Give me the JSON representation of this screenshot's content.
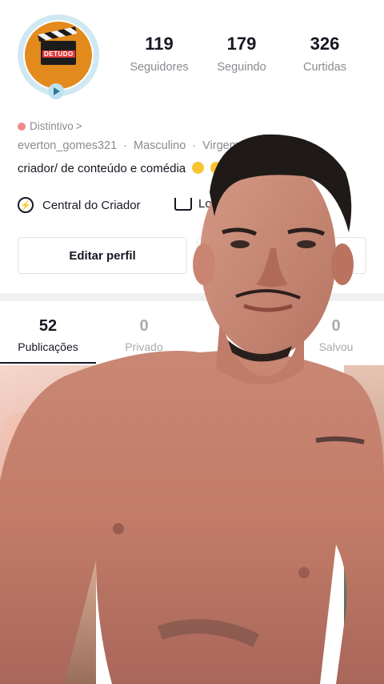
{
  "profile": {
    "username": "everton_gomes321",
    "gender": "Masculino",
    "sign": "Virgem",
    "badge_label": "Distintivo",
    "badge_chevron": ">",
    "bio": "criador/ de conteúdo e comédia",
    "avatar_text": "DETUDO"
  },
  "stats": [
    {
      "value": "119",
      "label": "Seguidores"
    },
    {
      "value": "179",
      "label": "Seguindo"
    },
    {
      "value": "326",
      "label": "Curtidas"
    }
  ],
  "actions": {
    "creator_center": "Central do Criador",
    "shop": "Loj",
    "edit_profile": "Editar perfil"
  },
  "tabs": [
    {
      "value": "52",
      "label": "Publicações",
      "active": true
    },
    {
      "value": "0",
      "label": "Privado",
      "active": false
    },
    {
      "value": "0",
      "label": "Salvou",
      "active": false
    }
  ],
  "icons": [
    "play-icon",
    "shield-icon",
    "lightning-icon",
    "cart-icon"
  ],
  "colors": {
    "text": "#161823",
    "muted": "#8a8b91",
    "accent_avatar": "#e38a1c",
    "badge": "#f08a8a"
  }
}
